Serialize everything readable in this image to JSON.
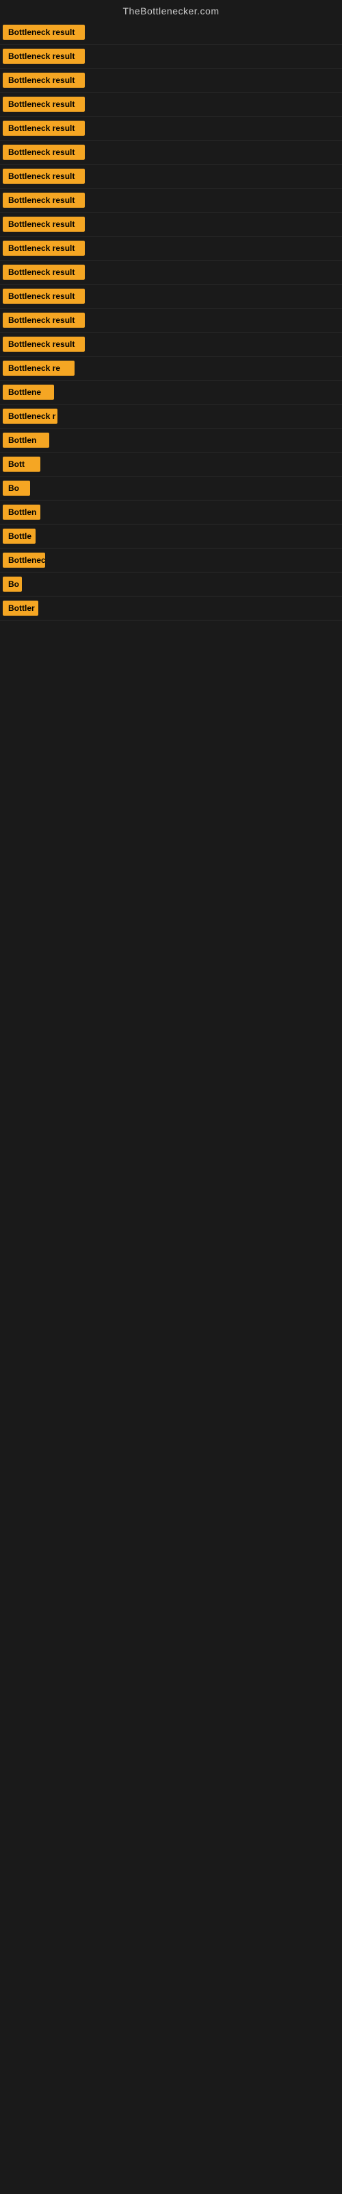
{
  "header": {
    "site_name": "TheBottlenecker.com"
  },
  "items": [
    {
      "id": 0,
      "label": "Bottleneck result"
    },
    {
      "id": 1,
      "label": "Bottleneck result"
    },
    {
      "id": 2,
      "label": "Bottleneck result"
    },
    {
      "id": 3,
      "label": "Bottleneck result"
    },
    {
      "id": 4,
      "label": "Bottleneck result"
    },
    {
      "id": 5,
      "label": "Bottleneck result"
    },
    {
      "id": 6,
      "label": "Bottleneck result"
    },
    {
      "id": 7,
      "label": "Bottleneck result"
    },
    {
      "id": 8,
      "label": "Bottleneck result"
    },
    {
      "id": 9,
      "label": "Bottleneck result"
    },
    {
      "id": 10,
      "label": "Bottleneck result"
    },
    {
      "id": 11,
      "label": "Bottleneck result"
    },
    {
      "id": 12,
      "label": "Bottleneck result"
    },
    {
      "id": 13,
      "label": "Bottleneck result"
    },
    {
      "id": 14,
      "label": "Bottleneck re"
    },
    {
      "id": 15,
      "label": "Bottlene"
    },
    {
      "id": 16,
      "label": "Bottleneck r"
    },
    {
      "id": 17,
      "label": "Bottlen"
    },
    {
      "id": 18,
      "label": "Bott"
    },
    {
      "id": 19,
      "label": "Bo"
    },
    {
      "id": 20,
      "label": "Bottlen"
    },
    {
      "id": 21,
      "label": "Bottle"
    },
    {
      "id": 22,
      "label": "Bottlenec"
    },
    {
      "id": 23,
      "label": "Bo"
    },
    {
      "id": 24,
      "label": "Bottler"
    }
  ]
}
